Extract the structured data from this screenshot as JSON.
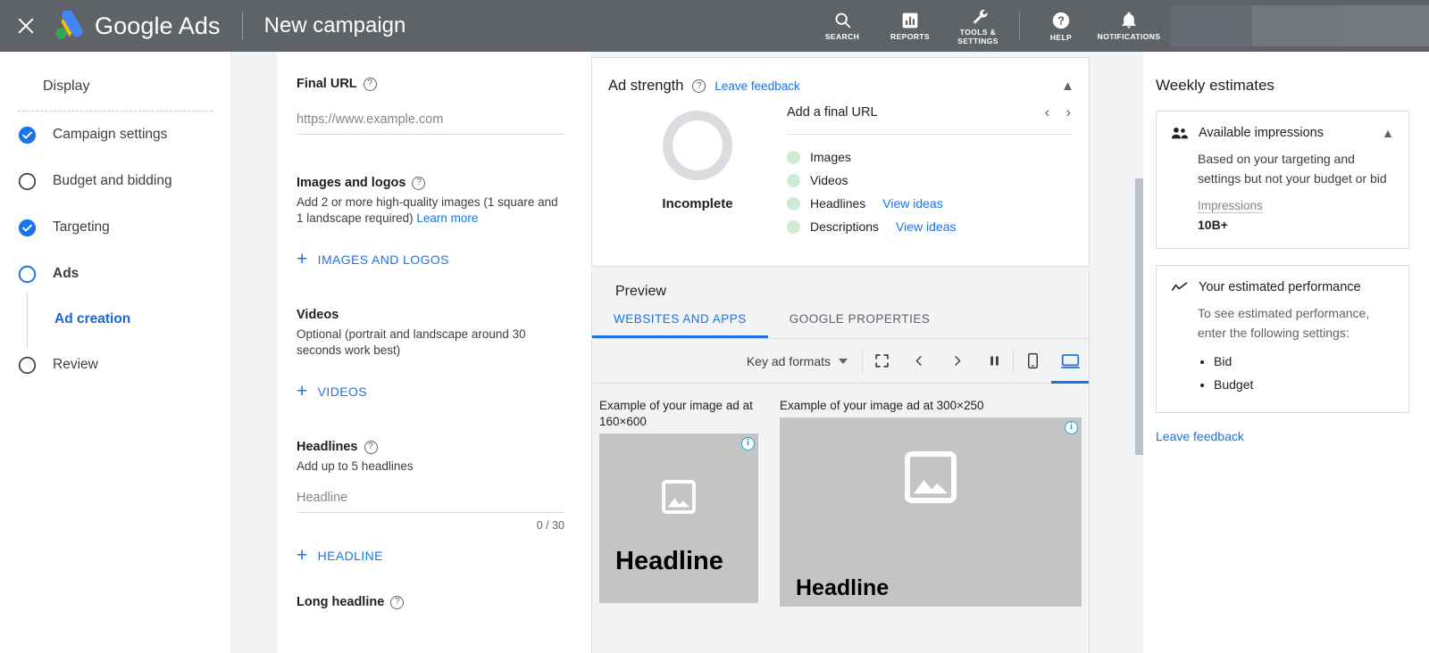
{
  "topbar": {
    "close_icon": "close-icon",
    "brand": "Google Ads",
    "subtitle": "New campaign",
    "items": [
      {
        "icon": "search-icon",
        "label": "SEARCH"
      },
      {
        "icon": "reports-icon",
        "label": "REPORTS"
      },
      {
        "icon": "tools-icon",
        "label": "TOOLS &\nSETTINGS"
      },
      {
        "icon": "help-icon",
        "label": "HELP"
      },
      {
        "icon": "notifications-icon",
        "label": "NOTIFICATIONS"
      }
    ],
    "item_labels": {
      "search": "SEARCH",
      "reports": "REPORTS",
      "tools_line1": "TOOLS &",
      "tools_line2": "SETTINGS",
      "help": "HELP",
      "notifications": "NOTIFICATIONS"
    }
  },
  "sidebar": {
    "display_label": "Display",
    "items": [
      {
        "label": "Campaign settings",
        "state": "complete"
      },
      {
        "label": "Budget and bidding",
        "state": "incomplete"
      },
      {
        "label": "Targeting",
        "state": "complete"
      },
      {
        "label": "Ads",
        "state": "current"
      },
      {
        "label": "Review",
        "state": "incomplete"
      }
    ],
    "subitem": {
      "label": "Ad creation",
      "active": true
    }
  },
  "form": {
    "final_url": {
      "label": "Final URL",
      "help_icon": "help-circle-icon",
      "placeholder": "https://www.example.com",
      "value": ""
    },
    "images_logos": {
      "label": "Images and logos",
      "help_icon": "help-circle-icon",
      "description": "Add 2 or more high-quality images (1 square and 1 landscape required)",
      "learn_more": "Learn more",
      "add_button": "IMAGES AND LOGOS"
    },
    "videos": {
      "label": "Videos",
      "description": "Optional (portrait and landscape around 30 seconds work best)",
      "add_button": "VIDEOS"
    },
    "headlines": {
      "label": "Headlines",
      "help_icon": "help-circle-icon",
      "description": "Add up to 5 headlines",
      "placeholder": "Headline",
      "value": "",
      "counter": "0 / 30",
      "add_button": "HEADLINE"
    },
    "long_headline": {
      "label": "Long headline",
      "help_icon": "help-circle-icon"
    }
  },
  "ad_strength": {
    "title": "Ad strength",
    "help_icon": "help-circle-icon",
    "feedback_link": "Leave feedback",
    "collapse_icon": "chevron-up-icon",
    "status": "Incomplete",
    "ring_color": "#dadce0",
    "suggestion": "Add a final URL",
    "prev_icon": "chevron-left-icon",
    "next_icon": "chevron-right-icon",
    "checklist": [
      {
        "label": "Images",
        "ideas": ""
      },
      {
        "label": "Videos",
        "ideas": ""
      },
      {
        "label": "Headlines",
        "ideas": "View ideas"
      },
      {
        "label": "Descriptions",
        "ideas": "View ideas"
      }
    ],
    "dot_color": "#ceead6"
  },
  "preview": {
    "title": "Preview",
    "tabs": [
      {
        "label": "WEBSITES AND APPS",
        "active": true
      },
      {
        "label": "GOOGLE PROPERTIES",
        "active": false
      }
    ],
    "toolbar": {
      "format_select": "Key ad formats",
      "dropdown_icon": "chevron-down-icon",
      "fullscreen_icon": "fullscreen-icon",
      "prev_icon": "chevron-left-icon",
      "next_icon": "chevron-right-icon",
      "pause_icon": "pause-icon",
      "mobile_icon": "mobile-icon",
      "desktop_icon": "desktop-icon",
      "active_device": "desktop"
    },
    "ads": [
      {
        "caption": "Example of your image ad at 160×600",
        "headline": "Headline",
        "info_icon": "info-icon",
        "placeholder_icon": "image-placeholder-icon"
      },
      {
        "caption": "Example of your image ad at 300×250",
        "headline": "Headline",
        "info_icon": "info-icon",
        "placeholder_icon": "image-placeholder-icon"
      }
    ]
  },
  "estimates": {
    "title": "Weekly estimates",
    "impressions_card": {
      "icon": "people-icon",
      "title": "Available impressions",
      "chevron": "chevron-up-icon",
      "description": "Based on your targeting and settings but not your budget or bid",
      "metric_label": "Impressions",
      "metric_value": "10B+"
    },
    "performance_card": {
      "icon": "trend-line-icon",
      "title": "Your estimated performance",
      "description": "To see estimated performance, enter the following settings:",
      "bullets": [
        "Bid",
        "Budget"
      ]
    },
    "feedback_link": "Leave feedback"
  },
  "colors": {
    "topbar_bg": "#5f6368",
    "accent_blue": "#1a73e8",
    "link_blue": "#1967d2",
    "page_bg": "#f1f3f4"
  }
}
